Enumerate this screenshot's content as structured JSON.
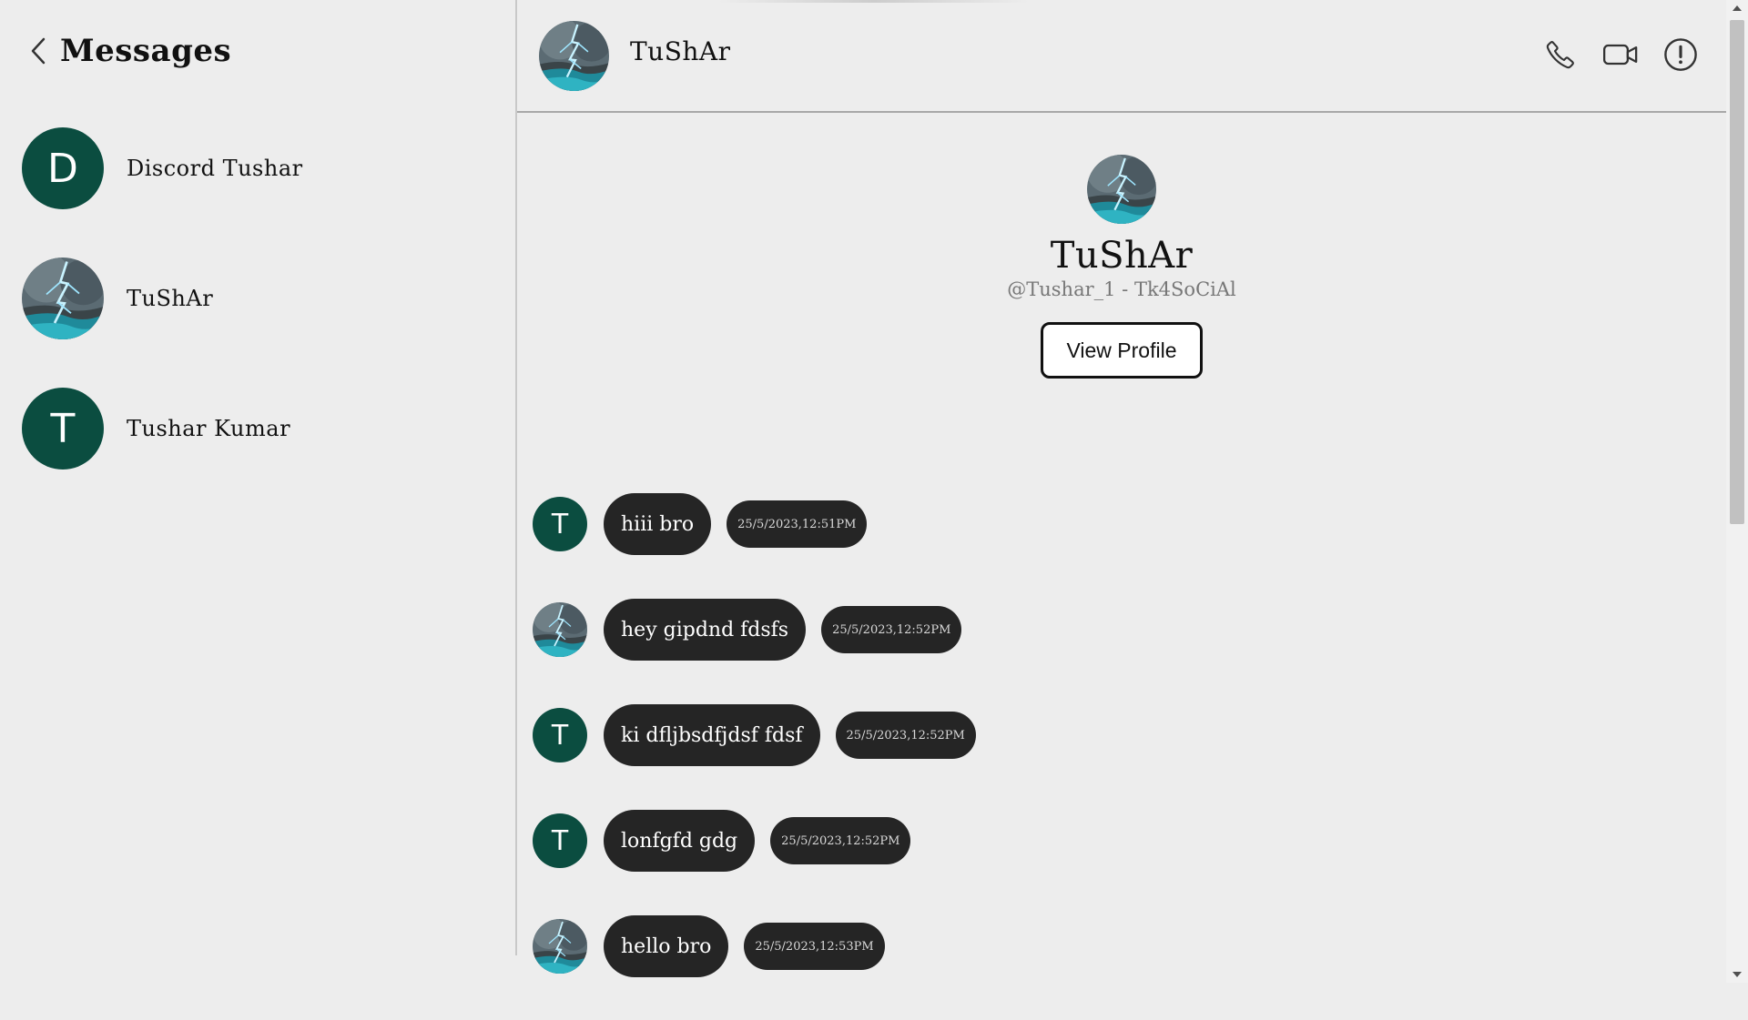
{
  "sidebar": {
    "title": "Messages",
    "back_icon": "chevron-left-icon",
    "conversations": [
      {
        "name": "Discord Tushar",
        "avatar_type": "letter",
        "letter": "D"
      },
      {
        "name": "TuShAr",
        "avatar_type": "image"
      },
      {
        "name": "Tushar Kumar",
        "avatar_type": "letter",
        "letter": "T"
      }
    ]
  },
  "chat": {
    "header": {
      "name": "TuShAr",
      "actions": [
        "phone-icon",
        "video-camera-icon",
        "info-alert-icon"
      ]
    },
    "profile": {
      "name": "TuShAr",
      "handle": "@Tushar_1 - Tk4SoCiAl",
      "view_button": "View Profile"
    },
    "messages": [
      {
        "avatar_type": "letter",
        "letter": "T",
        "text": "hiii bro",
        "time": "25/5/2023,12:51PM"
      },
      {
        "avatar_type": "image",
        "text": "hey gipdnd fdsfs",
        "time": "25/5/2023,12:52PM"
      },
      {
        "avatar_type": "letter",
        "letter": "T",
        "text": "ki dfljbsdfjdsf fdsf",
        "time": "25/5/2023,12:52PM"
      },
      {
        "avatar_type": "letter",
        "letter": "T",
        "text": "lonfgfd gdg",
        "time": "25/5/2023,12:52PM"
      },
      {
        "avatar_type": "image",
        "text": "hello bro",
        "time": "25/5/2023,12:53PM"
      }
    ]
  },
  "colors": {
    "background": "#ededed",
    "avatar_green": "#0b4d40",
    "bubble": "#252525"
  }
}
